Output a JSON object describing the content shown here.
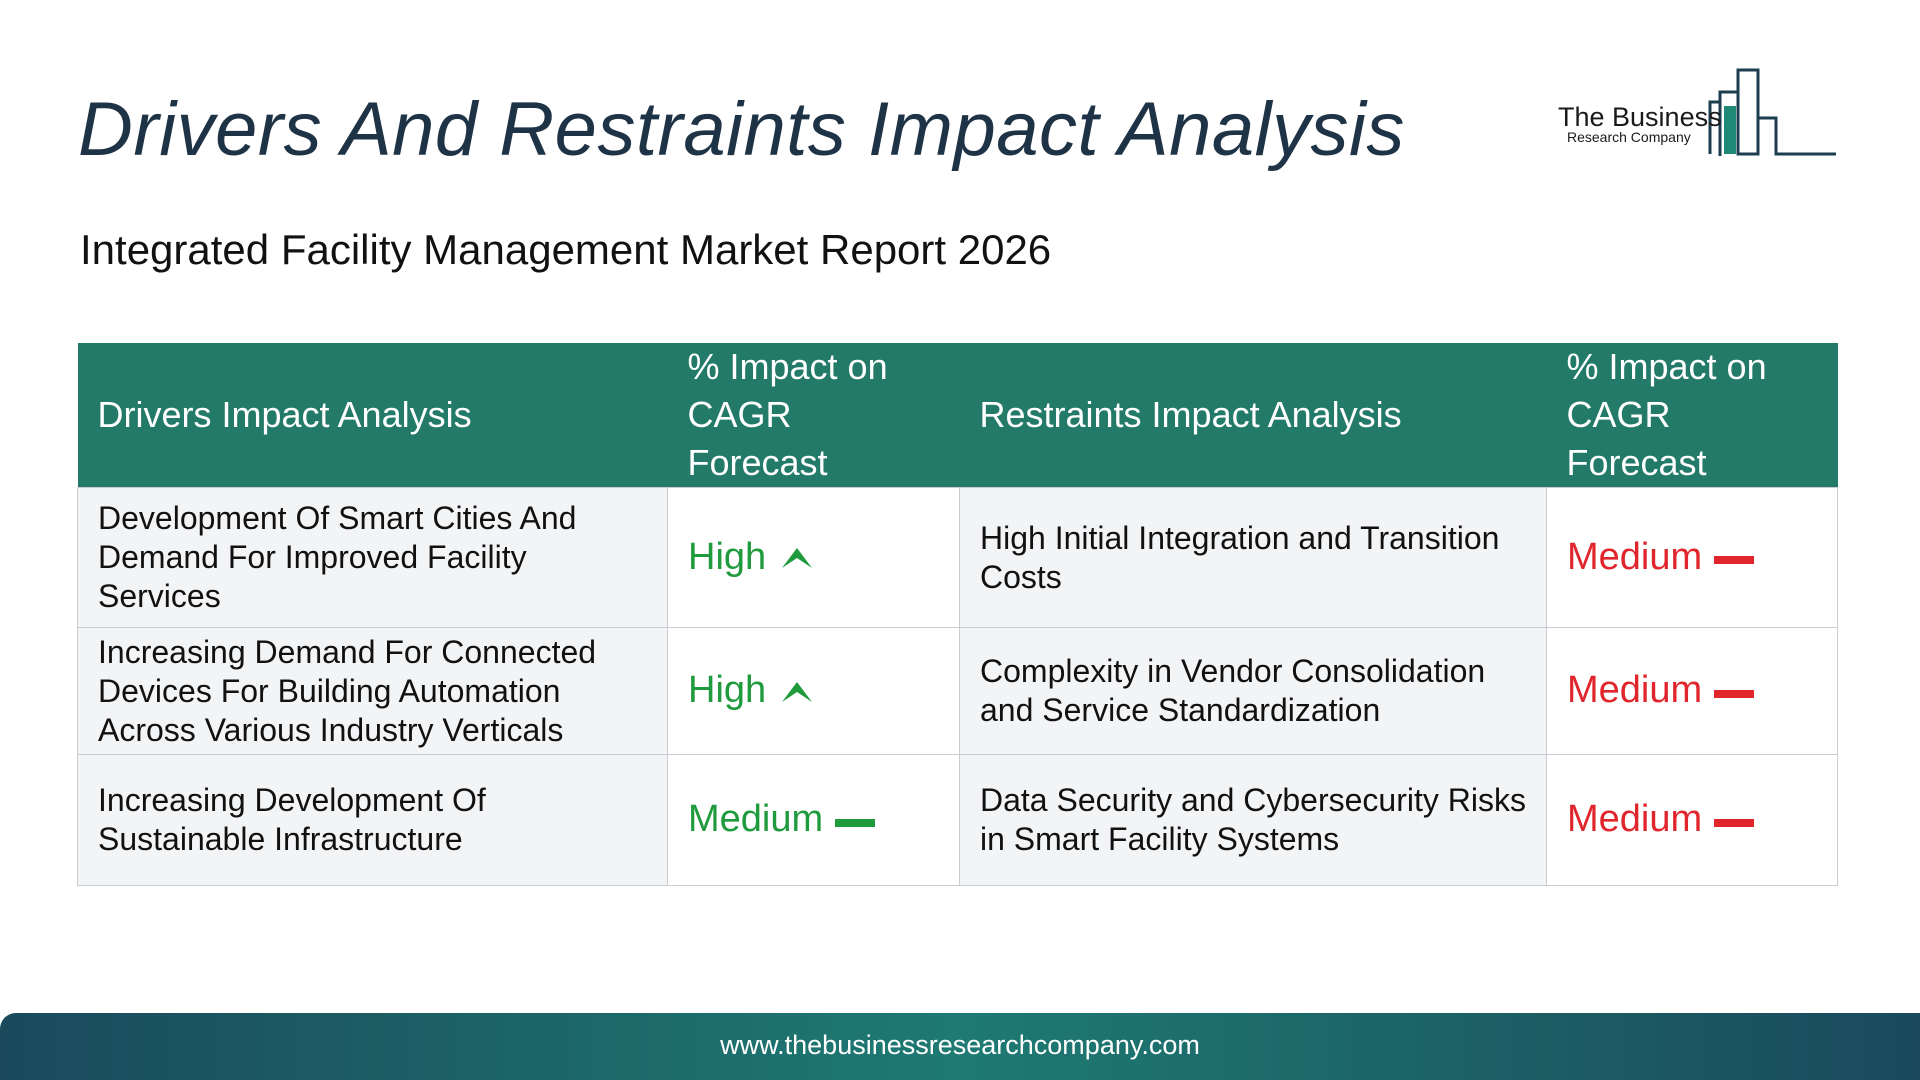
{
  "page": {
    "title": "Drivers And Restraints Impact Analysis",
    "subtitle": "Integrated Facility Management Market Report 2026"
  },
  "logo": {
    "name": "The Business",
    "sub": "Research Company"
  },
  "table": {
    "headers": {
      "drivers": "Drivers Impact Analysis",
      "drivers_impact": "% Impact on CAGR Forecast",
      "restraints": "Restraints Impact Analysis",
      "restraints_impact": "% Impact on CAGR Forecast"
    },
    "rows": [
      {
        "driver": "Development Of Smart Cities And Demand For Improved Facility Services",
        "driver_impact": "High",
        "driver_icon": "arrow-up-icon",
        "restraint": "High Initial Integration and Transition Costs",
        "restraint_impact": "Medium",
        "restraint_icon": "dash-icon"
      },
      {
        "driver": "Increasing Demand For Connected Devices For Building Automation Across Various Industry Verticals",
        "driver_impact": "High",
        "driver_icon": "arrow-up-icon",
        "restraint": "Complexity in Vendor Consolidation and Service Standardization",
        "restraint_impact": "Medium",
        "restraint_icon": "dash-icon"
      },
      {
        "driver": "Increasing Development Of Sustainable Infrastructure",
        "driver_impact": "Medium",
        "driver_icon": "dash-icon",
        "restraint": "Data Security and Cybersecurity Risks in Smart Facility Systems",
        "restraint_impact": "Medium",
        "restraint_icon": "dash-icon"
      }
    ]
  },
  "colors": {
    "header_bg": "#237a68",
    "driver_positive": "#1f9a3c",
    "restraint_negative": "#e0262c",
    "title": "#1f3346"
  },
  "footer": {
    "url": "www.thebusinessresearchcompany.com"
  }
}
